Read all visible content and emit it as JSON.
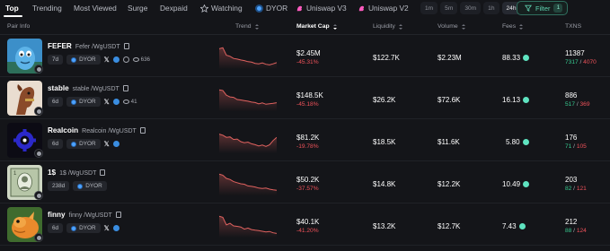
{
  "nav": {
    "tabs": [
      {
        "label": "Top",
        "active": true
      },
      {
        "label": "Trending"
      },
      {
        "label": "Most Viewed"
      },
      {
        "label": "Surge"
      },
      {
        "label": "Dexpaid"
      },
      {
        "label": "Watching",
        "icon": "star-icon"
      },
      {
        "label": "DYOR",
        "icon": "dyor-icon"
      },
      {
        "label": "Uniswap V3",
        "icon": "uniswap-icon"
      },
      {
        "label": "Uniswap V2",
        "icon": "uniswap-icon"
      }
    ],
    "timeframes": [
      "1m",
      "5m",
      "30m",
      "1h",
      "24h"
    ],
    "active_timeframe": "24h",
    "filter_label": "Filter",
    "filter_count": "1"
  },
  "columns": {
    "pair_info": "Pair Info",
    "trend": "Trend",
    "market_cap": "Market Cap",
    "liquidity": "Liquidity",
    "volume": "Volume",
    "fees": "Fees",
    "txns": "TXNS"
  },
  "rows": [
    {
      "name": "FEFER",
      "pair": "Fefer /WgUSDT",
      "age": "7d",
      "dyor": "DYOR",
      "holders": "636",
      "show_globe": true,
      "market_cap": "$2.45M",
      "mc_change": "-45.31%",
      "liquidity": "$122.7K",
      "volume": "$2.23M",
      "fees": "88.33",
      "txns": "11387",
      "buys": "7317",
      "sells": "4070",
      "trend": [
        0.9,
        0.95,
        0.6,
        0.55,
        0.45,
        0.42,
        0.38,
        0.35,
        0.3,
        0.28,
        0.22,
        0.2,
        0.24,
        0.18,
        0.15,
        0.2,
        0.26
      ]
    },
    {
      "name": "stable",
      "pair": "stable /WgUSDT",
      "age": "6d",
      "dyor": "DYOR",
      "holders": "41",
      "show_globe": false,
      "market_cap": "$148.5K",
      "mc_change": "-45.18%",
      "liquidity": "$26.2K",
      "volume": "$72.6K",
      "fees": "16.13",
      "txns": "886",
      "buys": "517",
      "sells": "369",
      "trend": [
        0.95,
        0.92,
        0.7,
        0.62,
        0.6,
        0.5,
        0.48,
        0.45,
        0.42,
        0.38,
        0.36,
        0.3,
        0.34,
        0.28,
        0.3,
        0.32,
        0.35
      ]
    },
    {
      "name": "Realcoin",
      "pair": "Realcoin /WgUSDT",
      "age": "6d",
      "dyor": "DYOR",
      "holders": "",
      "show_globe": false,
      "market_cap": "$81.2K",
      "mc_change": "-19.78%",
      "liquidity": "$18.5K",
      "volume": "$11.6K",
      "fees": "5.80",
      "txns": "176",
      "buys": "71",
      "sells": "105",
      "trend": [
        0.85,
        0.8,
        0.7,
        0.72,
        0.6,
        0.62,
        0.5,
        0.45,
        0.48,
        0.4,
        0.36,
        0.3,
        0.34,
        0.28,
        0.35,
        0.55,
        0.7
      ]
    },
    {
      "name": "1$",
      "pair": "1$ /WgUSDT",
      "age": "238d",
      "dyor": "DYOR",
      "holders": "",
      "show_globe": false,
      "no_socials": true,
      "market_cap": "$50.2K",
      "mc_change": "-37.57%",
      "liquidity": "$14.8K",
      "volume": "$12.2K",
      "fees": "10.49",
      "txns": "203",
      "buys": "82",
      "sells": "121",
      "trend": [
        0.95,
        0.9,
        0.75,
        0.7,
        0.6,
        0.55,
        0.5,
        0.48,
        0.4,
        0.38,
        0.35,
        0.3,
        0.28,
        0.3,
        0.25,
        0.22,
        0.2
      ]
    },
    {
      "name": "finny",
      "pair": "finny /WgUSDT",
      "age": "6d",
      "dyor": "DYOR",
      "holders": "",
      "show_globe": false,
      "market_cap": "$40.1K",
      "mc_change": "-41.20%",
      "liquidity": "$13.2K",
      "volume": "$12.7K",
      "fees": "7.43",
      "txns": "212",
      "buys": "88",
      "sells": "124",
      "trend": [
        0.95,
        0.9,
        0.55,
        0.62,
        0.5,
        0.48,
        0.45,
        0.35,
        0.4,
        0.33,
        0.3,
        0.28,
        0.25,
        0.22,
        0.24,
        0.18,
        0.15
      ]
    }
  ],
  "colors": {
    "negative": "#f0525a",
    "positive": "#36c98f",
    "accent": "#5fd3b1",
    "spark_line": "#e0625f"
  }
}
